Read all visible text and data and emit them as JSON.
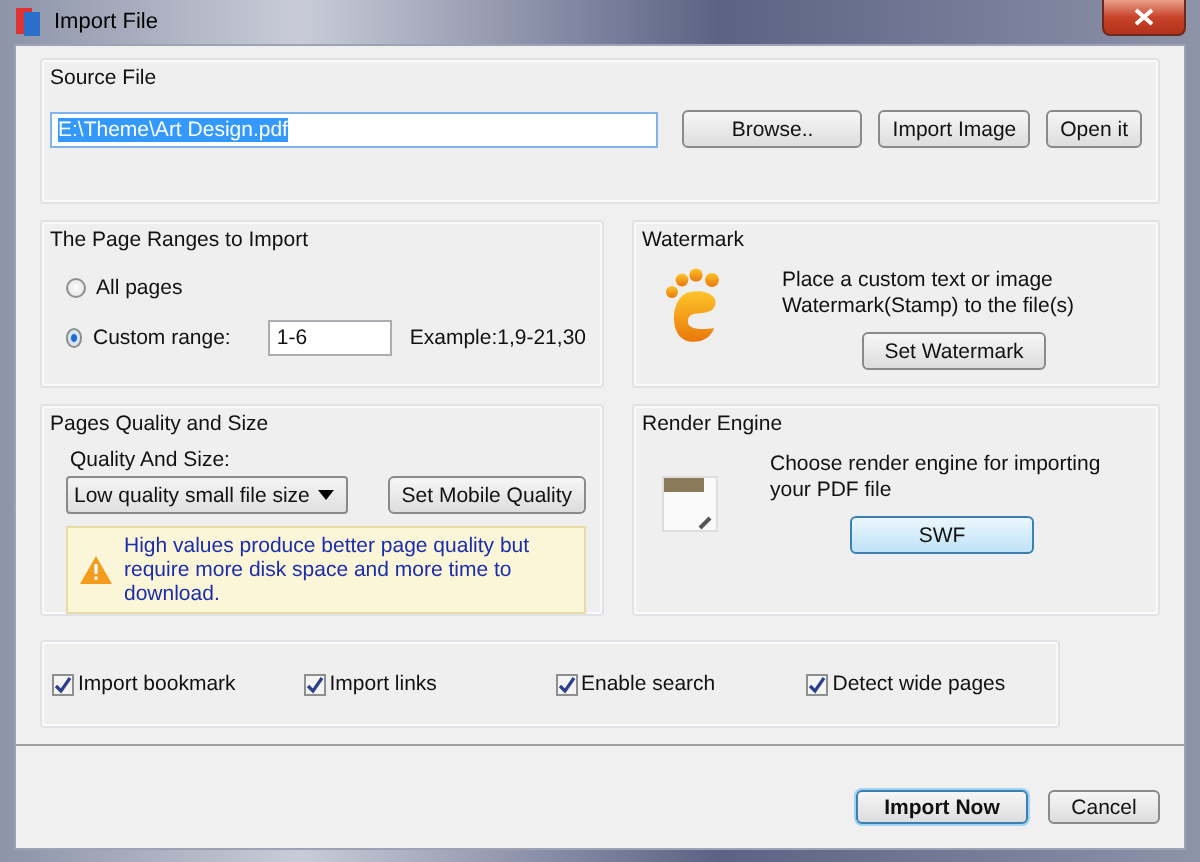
{
  "window": {
    "title": "Import File"
  },
  "source_file": {
    "title": "Source File",
    "path": "E:\\Theme\\Art Design.pdf",
    "buttons": [
      "Browse..",
      "Import Image",
      "Open it"
    ]
  },
  "page_ranges": {
    "title": "The Page Ranges to Import",
    "options": [
      {
        "label": "All pages",
        "selected": false
      },
      {
        "label": "Custom range:",
        "selected": true
      }
    ],
    "range": "1-6",
    "example": "Example:1,9-21,30"
  },
  "watermark": {
    "title": "Watermark",
    "description": "Place a custom text or image Watermark(Stamp) to the file(s)",
    "button": "Set Watermark"
  },
  "quality": {
    "title": "Pages Quality and Size",
    "label": "Quality And Size:",
    "value": "Low quality small file size",
    "button": "Set Mobile Quality",
    "warning": "High values produce better page quality but require more disk space and more time to download."
  },
  "render_engine": {
    "title": "Render Engine",
    "description": "Choose render engine for importing your PDF file",
    "button": "SWF"
  },
  "options": [
    {
      "label": "Import bookmark",
      "checked": true
    },
    {
      "label": "Import links",
      "checked": true
    },
    {
      "label": "Enable search",
      "checked": true
    },
    {
      "label": "Detect wide pages",
      "checked": true
    }
  ],
  "buttons": [
    {
      "label": "Import Now",
      "default": true
    },
    {
      "label": "Cancel",
      "default": false
    }
  ]
}
